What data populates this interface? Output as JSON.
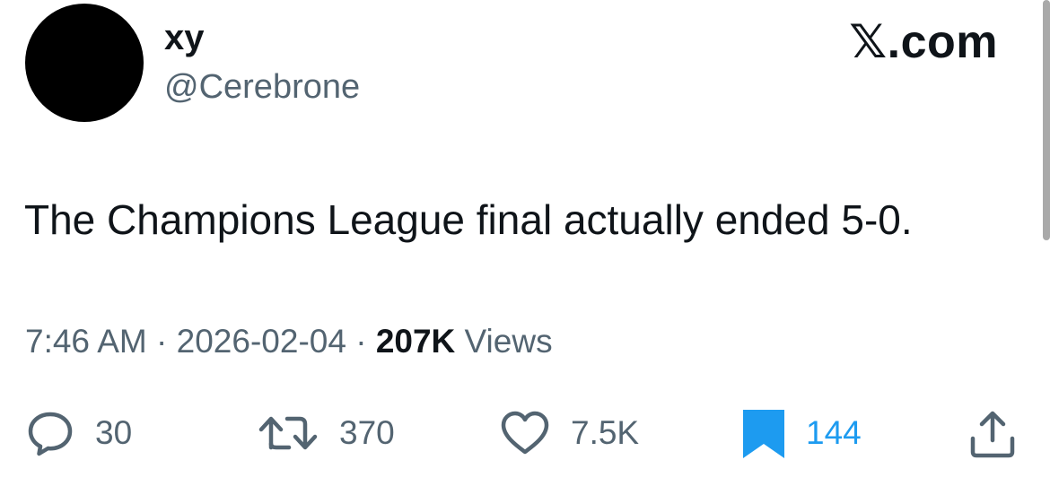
{
  "author": {
    "display_name": "xy",
    "handle": "@Cerebrone"
  },
  "brand": {
    "label": "𝕏.com"
  },
  "tweet": {
    "text": "The Champions League final actually ended 5-0.",
    "time": "7:46 AM",
    "separator": " · ",
    "date": "2026-02-04",
    "views_count": "207K",
    "views_label": " Views"
  },
  "actions": {
    "reply": {
      "icon": "reply-icon",
      "count": "30"
    },
    "retweet": {
      "icon": "retweet-icon",
      "count": "370"
    },
    "like": {
      "icon": "heart-icon",
      "count": "7.5K"
    },
    "bookmark": {
      "icon": "bookmark-icon",
      "count": "144",
      "active": true
    },
    "share": {
      "icon": "share-icon"
    }
  },
  "colors": {
    "text_primary": "#0f1419",
    "text_secondary": "#536471",
    "accent": "#1d9bf0",
    "avatar": "#000000"
  }
}
